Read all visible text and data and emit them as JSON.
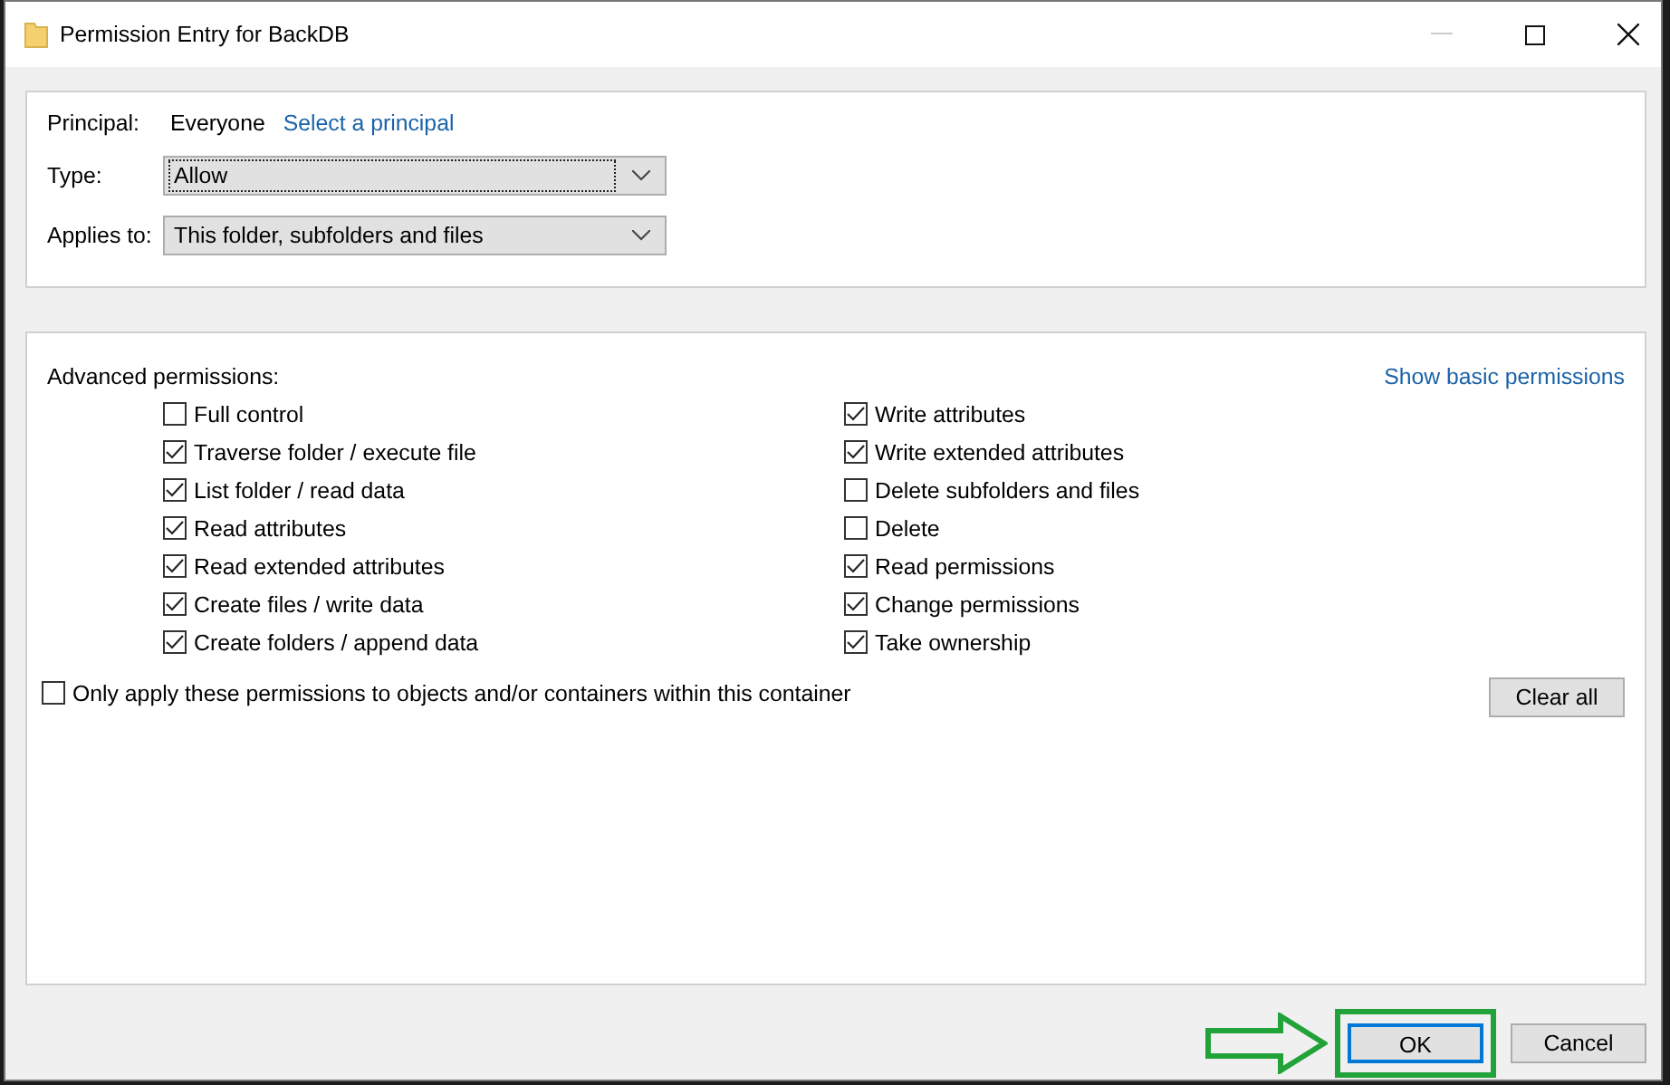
{
  "window": {
    "title": "Permission Entry for BackDB"
  },
  "principal": {
    "label": "Principal:",
    "value": "Everyone",
    "link": "Select a principal"
  },
  "type": {
    "label": "Type:",
    "value": "Allow"
  },
  "applies_to": {
    "label": "Applies to:",
    "value": "This folder, subfolders and files"
  },
  "advanced": {
    "label": "Advanced permissions:",
    "link": "Show basic permissions",
    "left": [
      {
        "label": "Full control",
        "checked": false
      },
      {
        "label": "Traverse folder / execute file",
        "checked": true
      },
      {
        "label": "List folder / read data",
        "checked": true
      },
      {
        "label": "Read attributes",
        "checked": true
      },
      {
        "label": "Read extended attributes",
        "checked": true
      },
      {
        "label": "Create files / write data",
        "checked": true
      },
      {
        "label": "Create folders / append data",
        "checked": true
      }
    ],
    "right": [
      {
        "label": "Write attributes",
        "checked": true
      },
      {
        "label": "Write extended attributes",
        "checked": true
      },
      {
        "label": "Delete subfolders and files",
        "checked": false
      },
      {
        "label": "Delete",
        "checked": false
      },
      {
        "label": "Read permissions",
        "checked": true
      },
      {
        "label": "Change permissions",
        "checked": true
      },
      {
        "label": "Take ownership",
        "checked": true
      }
    ],
    "only_apply": {
      "label": "Only apply these permissions to objects and/or containers within this container",
      "checked": false
    },
    "clear_button": "Clear all"
  },
  "buttons": [
    {
      "label": "OK",
      "highlighted": true
    },
    {
      "label": "Cancel",
      "highlighted": false
    }
  ]
}
